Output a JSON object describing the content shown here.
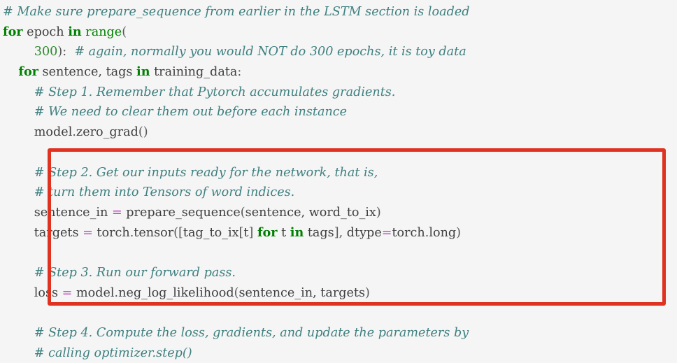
{
  "editor": {
    "language": "python",
    "background_color": "#f5f5f5",
    "default_text_color": "#404040",
    "comment_color": "#408080",
    "keyword_color": "#008000",
    "builtin_color": "#008000",
    "number_color": "#2e8b2e",
    "operator_color": "#bb44bb",
    "highlight_box_color": "#e03221"
  },
  "code": {
    "lines": [
      {
        "id": "line-1",
        "indent": 0,
        "tokens": [
          {
            "t": "c",
            "v": "# Make sure prepare_sequence from earlier in the LSTM section is loaded"
          }
        ]
      },
      {
        "id": "line-2",
        "indent": 0,
        "tokens": [
          {
            "t": "k",
            "v": "for"
          },
          {
            "t": "n",
            "v": " epoch "
          },
          {
            "t": "k",
            "v": "in"
          },
          {
            "t": "n",
            "v": " "
          },
          {
            "t": "nb",
            "v": "range"
          },
          {
            "t": "p",
            "v": "("
          }
        ]
      },
      {
        "id": "line-3",
        "indent": 0,
        "tokens": [
          {
            "t": "n",
            "v": "        "
          },
          {
            "t": "mi",
            "v": "300"
          },
          {
            "t": "p",
            "v": "):"
          },
          {
            "t": "n",
            "v": "  "
          },
          {
            "t": "c",
            "v": "# again, normally you would NOT do 300 epochs, it is toy data"
          }
        ]
      },
      {
        "id": "line-4",
        "indent": 0,
        "tokens": [
          {
            "t": "n",
            "v": "    "
          },
          {
            "t": "k",
            "v": "for"
          },
          {
            "t": "n",
            "v": " sentence, tags "
          },
          {
            "t": "k",
            "v": "in"
          },
          {
            "t": "n",
            "v": " training_data"
          },
          {
            "t": "p",
            "v": ":"
          }
        ]
      },
      {
        "id": "line-5",
        "indent": 0,
        "tokens": [
          {
            "t": "n",
            "v": "        "
          },
          {
            "t": "c",
            "v": "# Step 1. Remember that Pytorch accumulates gradients."
          }
        ]
      },
      {
        "id": "line-6",
        "indent": 0,
        "tokens": [
          {
            "t": "n",
            "v": "        "
          },
          {
            "t": "c",
            "v": "# We need to clear them out before each instance"
          }
        ]
      },
      {
        "id": "line-7",
        "indent": 0,
        "tokens": [
          {
            "t": "n",
            "v": "        model"
          },
          {
            "t": "p",
            "v": "."
          },
          {
            "t": "n",
            "v": "zero_grad"
          },
          {
            "t": "p",
            "v": "()"
          }
        ]
      },
      {
        "id": "line-8",
        "indent": 0,
        "tokens": [
          {
            "t": "n",
            "v": ""
          }
        ]
      },
      {
        "id": "line-9",
        "indent": 0,
        "tokens": [
          {
            "t": "n",
            "v": "        "
          },
          {
            "t": "c",
            "v": "# Step 2. Get our inputs ready for the network, that is,"
          }
        ]
      },
      {
        "id": "line-10",
        "indent": 0,
        "tokens": [
          {
            "t": "n",
            "v": "        "
          },
          {
            "t": "c",
            "v": "# turn them into Tensors of word indices."
          }
        ]
      },
      {
        "id": "line-11",
        "indent": 0,
        "tokens": [
          {
            "t": "n",
            "v": "        sentence_in "
          },
          {
            "t": "o",
            "v": "="
          },
          {
            "t": "n",
            "v": " prepare_sequence"
          },
          {
            "t": "p",
            "v": "("
          },
          {
            "t": "n",
            "v": "sentence, word_to_ix"
          },
          {
            "t": "p",
            "v": ")"
          }
        ]
      },
      {
        "id": "line-12",
        "indent": 0,
        "tokens": [
          {
            "t": "n",
            "v": "        targets "
          },
          {
            "t": "o",
            "v": "="
          },
          {
            "t": "n",
            "v": " torch"
          },
          {
            "t": "p",
            "v": "."
          },
          {
            "t": "n",
            "v": "tensor"
          },
          {
            "t": "p",
            "v": "(["
          },
          {
            "t": "n",
            "v": "tag_to_ix"
          },
          {
            "t": "p",
            "v": "["
          },
          {
            "t": "n",
            "v": "t"
          },
          {
            "t": "p",
            "v": "] "
          },
          {
            "t": "k",
            "v": "for"
          },
          {
            "t": "n",
            "v": " t "
          },
          {
            "t": "k",
            "v": "in"
          },
          {
            "t": "n",
            "v": " tags"
          },
          {
            "t": "p",
            "v": "], "
          },
          {
            "t": "n",
            "v": "dtype"
          },
          {
            "t": "o",
            "v": "="
          },
          {
            "t": "n",
            "v": "torch"
          },
          {
            "t": "p",
            "v": "."
          },
          {
            "t": "n",
            "v": "long"
          },
          {
            "t": "p",
            "v": ")"
          }
        ]
      },
      {
        "id": "line-13",
        "indent": 0,
        "tokens": [
          {
            "t": "n",
            "v": ""
          }
        ]
      },
      {
        "id": "line-14",
        "indent": 0,
        "tokens": [
          {
            "t": "n",
            "v": "        "
          },
          {
            "t": "c",
            "v": "# Step 3. Run our forward pass."
          }
        ]
      },
      {
        "id": "line-15",
        "indent": 0,
        "tokens": [
          {
            "t": "n",
            "v": "        loss "
          },
          {
            "t": "o",
            "v": "="
          },
          {
            "t": "n",
            "v": " model"
          },
          {
            "t": "p",
            "v": "."
          },
          {
            "t": "n",
            "v": "neg_log_likelihood"
          },
          {
            "t": "p",
            "v": "("
          },
          {
            "t": "n",
            "v": "sentence_in, targets"
          },
          {
            "t": "p",
            "v": ")"
          }
        ]
      },
      {
        "id": "line-16",
        "indent": 0,
        "tokens": [
          {
            "t": "n",
            "v": ""
          }
        ]
      },
      {
        "id": "line-17",
        "indent": 0,
        "tokens": [
          {
            "t": "n",
            "v": "        "
          },
          {
            "t": "c",
            "v": "# Step 4. Compute the loss, gradients, and update the parameters by"
          }
        ]
      },
      {
        "id": "line-18",
        "indent": 0,
        "tokens": [
          {
            "t": "n",
            "v": "        "
          },
          {
            "t": "c",
            "v": "# calling optimizer.step()"
          }
        ]
      }
    ]
  },
  "annotation": {
    "label": "highlight-rectangle",
    "color": "#e03221",
    "covers_lines": [
      "line-9",
      "line-10",
      "line-11",
      "line-12",
      "line-13",
      "line-14",
      "line-15"
    ]
  }
}
